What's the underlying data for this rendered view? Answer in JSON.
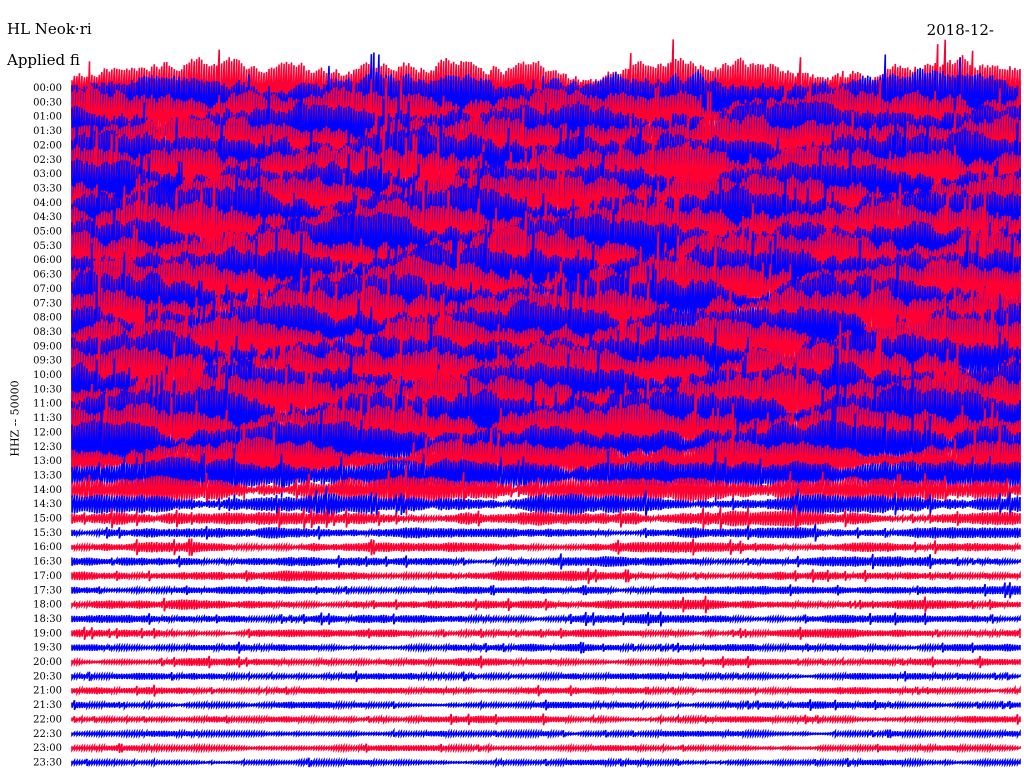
{
  "header": {
    "title": "HL Neok·ri",
    "subtitle": "Applied fi",
    "date": "2018-12-"
  },
  "chart_data": {
    "type": "line",
    "title": "HL Neok·ri",
    "subtitle": "Applied fi",
    "ylabel": "HHZ -- 50000",
    "categories": [
      "00:00",
      "00:30",
      "01:00",
      "01:30",
      "02:00",
      "02:30",
      "03:00",
      "03:30",
      "04:00",
      "04:30",
      "05:00",
      "05:30",
      "06:00",
      "06:30",
      "07:00",
      "07:30",
      "08:00",
      "08:30",
      "09:00",
      "09:30",
      "10:00",
      "10:30",
      "11:00",
      "11:30",
      "12:00",
      "12:30",
      "13:00",
      "13:30",
      "14:00",
      "14:30",
      "15:00",
      "15:30",
      "16:00",
      "16:30",
      "17:00",
      "17:30",
      "18:00",
      "18:30",
      "19:00",
      "19:30",
      "20:00",
      "20:30",
      "21:00",
      "21:30",
      "22:00",
      "22:30",
      "23:00",
      "23:30"
    ],
    "amplitude": [
      6.0,
      6.0,
      6.0,
      6.0,
      6.0,
      6.0,
      6.0,
      6.0,
      6.0,
      6.0,
      6.0,
      6.0,
      6.0,
      6.0,
      6.0,
      6.0,
      6.0,
      6.0,
      6.0,
      6.0,
      6.0,
      6.0,
      6.0,
      6.0,
      5.6,
      5.0,
      4.2,
      3.4,
      2.6,
      1.9,
      1.35,
      1.1,
      1.0,
      0.95,
      0.9,
      0.85,
      0.85,
      0.8,
      0.75,
      0.7,
      0.7,
      0.65,
      0.65,
      0.6,
      0.6,
      0.55,
      0.55,
      0.5
    ],
    "trace_colors": [
      "#ff0033",
      "#0000ff"
    ],
    "grid": false
  }
}
